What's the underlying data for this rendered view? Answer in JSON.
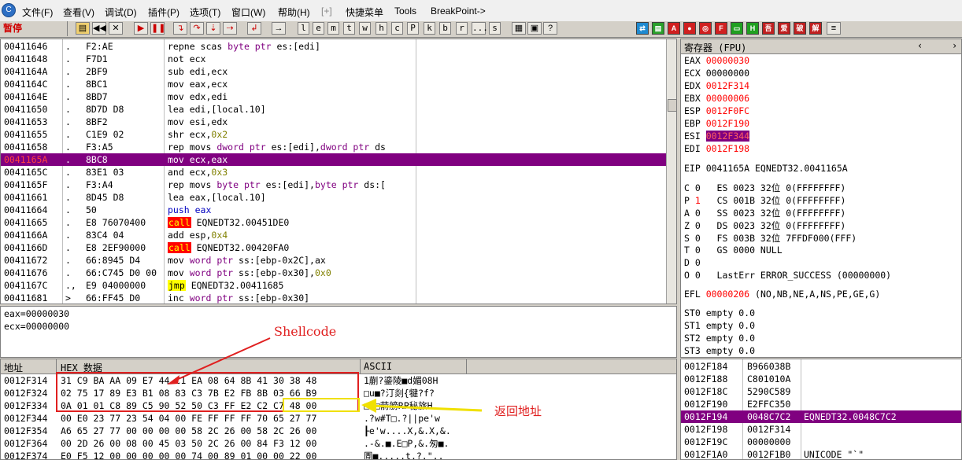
{
  "menubar": {
    "items": [
      "文件(F)",
      "查看(V)",
      "调试(D)",
      "插件(P)",
      "选项(T)",
      "窗口(W)",
      "帮助(H)",
      "[+]",
      "快捷菜单",
      "Tools",
      "BreakPoint->"
    ]
  },
  "toolbar": {
    "status": "暂停",
    "letters": [
      "l",
      "e",
      "m",
      "t",
      "w",
      "h",
      "c",
      "P",
      "k",
      "b",
      "r",
      "...",
      "s"
    ],
    "right_labels": [
      "A",
      "F",
      "H",
      "吾",
      "爱",
      "破",
      "解"
    ]
  },
  "disasm": {
    "rows": [
      {
        "addr": "00411646",
        "mark": ".",
        "hex": "F2:AE",
        "asm": "repne scas byte ptr es:[edi]"
      },
      {
        "addr": "00411648",
        "mark": ".",
        "hex": "F7D1",
        "asm": "not ecx"
      },
      {
        "addr": "0041164A",
        "mark": ".",
        "hex": "2BF9",
        "asm": "sub edi,ecx"
      },
      {
        "addr": "0041164C",
        "mark": ".",
        "hex": "8BC1",
        "asm": "mov eax,ecx"
      },
      {
        "addr": "0041164E",
        "mark": ".",
        "hex": "8BD7",
        "asm": "mov edx,edi"
      },
      {
        "addr": "00411650",
        "mark": ".",
        "hex": "8D7D D8",
        "asm": "lea edi,[local.10]"
      },
      {
        "addr": "00411653",
        "mark": ".",
        "hex": "8BF2",
        "asm": "mov esi,edx"
      },
      {
        "addr": "00411655",
        "mark": ".",
        "hex": "C1E9 02",
        "asm": "shr ecx,0x2"
      },
      {
        "addr": "00411658",
        "mark": ".",
        "hex": "F3:A5",
        "asm": "rep movs dword ptr es:[edi],dword ptr ds"
      },
      {
        "addr": "0041165A",
        "mark": ".",
        "hex": "8BC8",
        "asm": "mov ecx,eax"
      },
      {
        "addr": "0041165C",
        "mark": ".",
        "hex": "83E1 03",
        "asm": "and ecx,0x3"
      },
      {
        "addr": "0041165F",
        "mark": ".",
        "hex": "F3:A4",
        "asm": "rep movs byte ptr es:[edi],byte ptr ds:["
      },
      {
        "addr": "00411661",
        "mark": ".",
        "hex": "8D45 D8",
        "asm": "lea eax,[local.10]"
      },
      {
        "addr": "00411664",
        "mark": ".",
        "hex": "50",
        "asm": "push eax"
      },
      {
        "addr": "00411665",
        "mark": ".",
        "hex": "E8 76070400",
        "asm": "call EQNEDT32.00451DE0"
      },
      {
        "addr": "0041166A",
        "mark": ".",
        "hex": "83C4 04",
        "asm": "add esp,0x4"
      },
      {
        "addr": "0041166D",
        "mark": ".",
        "hex": "E8 2EF90000",
        "asm": "call EQNEDT32.00420FA0"
      },
      {
        "addr": "00411672",
        "mark": ".",
        "hex": "66:8945 D4",
        "asm": "mov word ptr ss:[ebp-0x2C],ax"
      },
      {
        "addr": "00411676",
        "mark": ".",
        "hex": "66:C745 D0 00",
        "asm": "mov word ptr ss:[ebp-0x30],0x0"
      },
      {
        "addr": "0041167C",
        "mark": ".,",
        "hex": "E9 04000000",
        "asm": "jmp EQNEDT32.00411685"
      },
      {
        "addr": "00411681",
        "mark": ">",
        "hex": "66:FF45 D0",
        "asm": "inc word ptr ss:[ebp-0x30]"
      }
    ]
  },
  "info": {
    "line1": "eax=00000030",
    "line2": "ecx=00000000"
  },
  "registers": {
    "title": "寄存器 (FPU)",
    "gpr": [
      {
        "name": "EAX",
        "value": "00000030"
      },
      {
        "name": "ECX",
        "value": "00000000"
      },
      {
        "name": "EDX",
        "value": "0012F314"
      },
      {
        "name": "EBX",
        "value": "00000006"
      },
      {
        "name": "ESP",
        "value": "0012F0FC"
      },
      {
        "name": "EBP",
        "value": "0012F190"
      },
      {
        "name": "ESI",
        "value": "0012F344"
      },
      {
        "name": "EDI",
        "value": "0012F198"
      }
    ],
    "eip": "EIP 0041165A EQNEDT32.0041165A",
    "flags": [
      "C 0   ES 0023 32位 0(FFFFFFFF)",
      "P 1   CS 001B 32位 0(FFFFFFFF)",
      "A 0   SS 0023 32位 0(FFFFFFFF)",
      "Z 0   DS 0023 32位 0(FFFFFFFF)",
      "S 0   FS 003B 32位 7FFDF000(FFF)",
      "T 0   GS 0000 NULL",
      "D 0",
      "O 0   LastErr ERROR_SUCCESS (00000000)"
    ],
    "efl_label": "EFL",
    "efl_value": "00000206",
    "efl_desc": "(NO,NB,NE,A,NS,PE,GE,G)",
    "fpu": [
      "ST0 empty 0.0",
      "ST1 empty 0.0",
      "ST2 empty 0.0",
      "ST3 empty 0.0"
    ]
  },
  "dump": {
    "header_addr": "地址",
    "header_hex": "HEX 数据",
    "header_ascii": "ASCII",
    "rows": [
      {
        "addr": "0012F314",
        "hex": "31 C9 BA AA 09 E7 44 C1 EA 08 64 8B 41 30 38 48",
        "ascii": "1蒯?鎏陵■d媚08H"
      },
      {
        "addr": "0012F324",
        "hex": "02 75 17 89 E3 B1 08 83 C3 7B E2 FB 8B 03 66 B9",
        "ascii": "□u■?汀剡{犍?f?"
      },
      {
        "addr": "0012F334",
        "hex": "0A 01 01 C8 89 C5 90 52 50 C3 FF E2 C2 C7 48 00",
        "ascii": "□□□葥艕RP秘旅H."
      },
      {
        "addr": "0012F344",
        "hex": "00 E0 23 77 23 54 04 00 FE FF FF FF 70 65 27 77",
        "ascii": ".?w#T□.?∣∣pe'w"
      },
      {
        "addr": "0012F354",
        "hex": "A6 65 27 77 00 00 00 00 58 2C 26 00 58 2C 26 00",
        "ascii": "┠e'w....X,&.X,&."
      },
      {
        "addr": "0012F364",
        "hex": "00 2D 26 00 08 00 45 03 50 2C 26 00 84 F3 12 00",
        "ascii": ".-&.■.E□P,&.匆■."
      },
      {
        "addr": "0012F374",
        "hex": "E0 F5 12 00 00 00 00 00 74 00 89 01 00 00 22 00",
        "ascii": "圊■.....t.?.\".."
      }
    ]
  },
  "stack": {
    "rows": [
      {
        "addr": "0012F184",
        "val": "B966038B",
        "comment": ""
      },
      {
        "addr": "0012F188",
        "val": "C801010A",
        "comment": ""
      },
      {
        "addr": "0012F18C",
        "val": "5290C589",
        "comment": ""
      },
      {
        "addr": "0012F190",
        "val": "E2FFC350",
        "comment": ""
      },
      {
        "addr": "0012F194",
        "val": "0048C7C2",
        "comment": "EQNEDT32.0048C7C2"
      },
      {
        "addr": "0012F198",
        "val": "0012F314",
        "comment": ""
      },
      {
        "addr": "0012F19C",
        "val": "00000000",
        "comment": ""
      },
      {
        "addr": "0012F1A0",
        "val": "0012F1B0",
        "comment": "UNICODE \"`\""
      }
    ]
  },
  "annotations": {
    "shellcode": "Shellcode",
    "return_address": "返回地址"
  },
  "colors": {
    "selection": "#800080",
    "highlight_red": "#ff0000",
    "annotation_red": "#e02020",
    "annotation_yellow": "#f0e000"
  }
}
